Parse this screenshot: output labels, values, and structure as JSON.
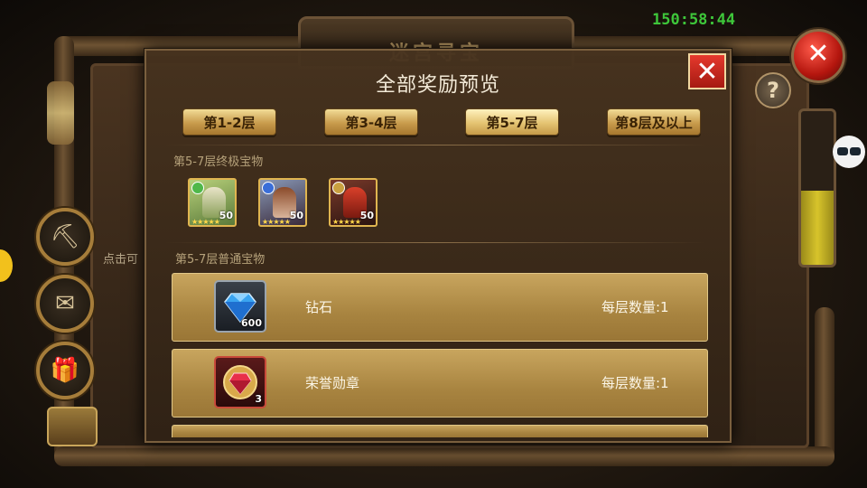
{
  "hud": {
    "timer": "150:58:44",
    "background_title": "迷宫寻宝",
    "side_hint": "点击可"
  },
  "modal": {
    "title": "全部奖励预览",
    "close_symbol": "✕",
    "tabs": [
      {
        "label": "第1-2层",
        "active": false
      },
      {
        "label": "第3-4层",
        "active": false
      },
      {
        "label": "第5-7层",
        "active": true
      },
      {
        "label": "第8层及以上",
        "active": false
      }
    ],
    "ultimate_label": "第5-7层终极宝物",
    "heroes": [
      {
        "level": "50",
        "stars": "★★★★★",
        "element_color": "#4fb84a"
      },
      {
        "level": "50",
        "stars": "★★★★★",
        "element_color": "#3a6ed8"
      },
      {
        "level": "50",
        "stars": "★★★★★",
        "element_color": "#c9a040"
      }
    ],
    "normal_label": "第5-7层普通宝物",
    "items": [
      {
        "name": "钻石",
        "count": "600",
        "quantity": "每层数量:1",
        "icon": "diamond-icon"
      },
      {
        "name": "荣誉勋章",
        "count": "3",
        "quantity": "每层数量:1",
        "icon": "honor-medal-icon"
      }
    ]
  },
  "colors": {
    "accent_gold": "#c89b4c",
    "close_red": "#e5392d",
    "timer_green": "#3ec63a"
  }
}
